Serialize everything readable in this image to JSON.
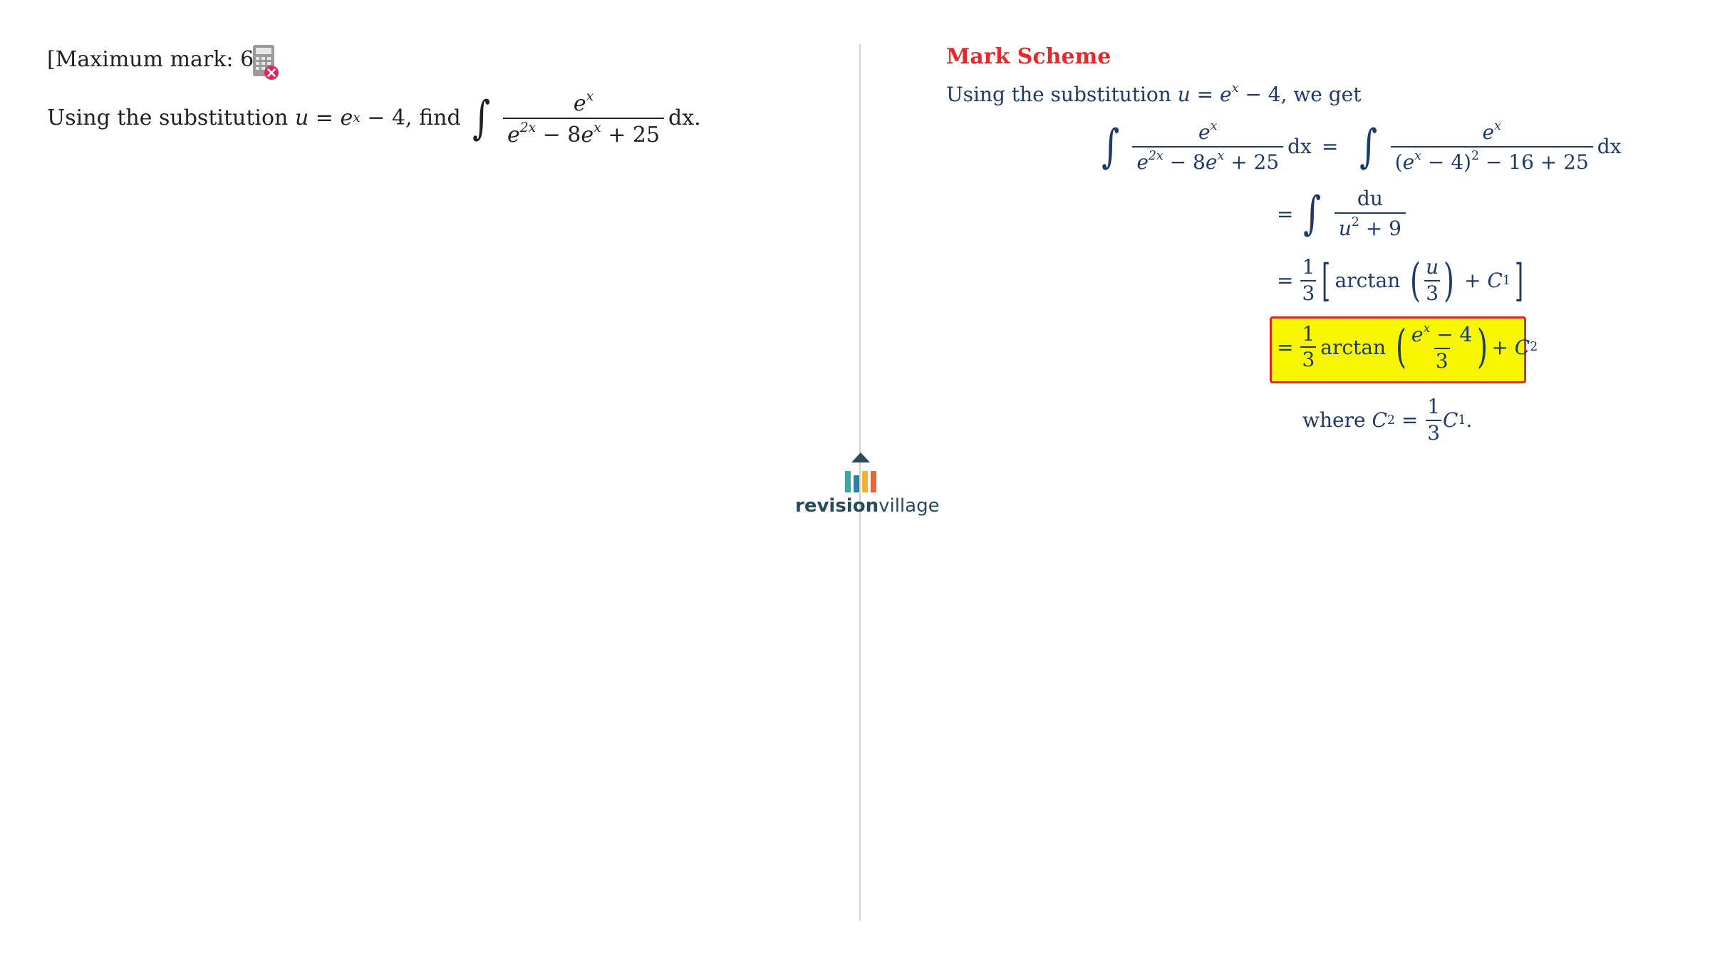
{
  "question": {
    "max_mark": "[Maximum mark: 6]",
    "calculator_icon": "calculator-not-allowed-icon",
    "text_prefix": "Using the substitution",
    "sub_u": "u",
    "sub_eq": " = ",
    "sub_e": "e",
    "sub_x": "x",
    "sub_tail": " − 4, find",
    "integral": "∫",
    "num_e": "e",
    "num_x": "x",
    "den_e1": "e",
    "den_2x": "2x",
    "den_mid": " − 8",
    "den_e2": "e",
    "den_x": "x",
    "den_tail": " + 25",
    "dx": "dx."
  },
  "mark_scheme": {
    "title": "Mark Scheme",
    "intro_prefix": "Using the substitution",
    "intro_u": "u",
    "intro_eq": " = ",
    "intro_e": "e",
    "intro_x": "x",
    "intro_tail": " − 4, we get",
    "step1": {
      "int": "∫",
      "num_e": "e",
      "num_x": "x",
      "den_e1": "e",
      "den_2x": "2x",
      "den_mid": " − 8",
      "den_e2": "e",
      "den_x": "x",
      "den_tail": " + 25",
      "dx": "dx",
      "eq": "=",
      "int2": "∫",
      "num2_e": "e",
      "num2_x": "x",
      "den2_open": "(",
      "den2_e": "e",
      "den2_x": "x",
      "den2_mid": " − 4)",
      "den2_sq": "2",
      "den2_tail": " − 16 + 25",
      "dx2": "dx"
    },
    "step2": {
      "eq": "=",
      "int": "∫",
      "num": "du",
      "den_u": "u",
      "den_sq": "2",
      "den_tail": " + 9"
    },
    "step3": {
      "eq": "=",
      "coef_num": "1",
      "coef_den": "3",
      "lbrack": "[",
      "arctan": "arctan",
      "lparen": "(",
      "frac_num": "u",
      "frac_den": "3",
      "rparen": ")",
      "plus": " + ",
      "c": "C",
      "c_sub": "1",
      "rbrack": "]"
    },
    "step4": {
      "eq": "=",
      "coef_num": "1",
      "coef_den": "3",
      "arctan": "arctan",
      "lparen": "(",
      "frac_num_e": "e",
      "frac_num_x": "x",
      "frac_num_tail": " − 4",
      "frac_den": "3",
      "rparen": ")",
      "plus": "+ ",
      "c": "C",
      "c_sub": "2"
    },
    "where": {
      "text": "where",
      "c": "C",
      "c_sub": "2",
      "eq": " = ",
      "coef_num": "1",
      "coef_den": "3",
      "c1": "C",
      "c1_sub": "1",
      "period": "."
    }
  },
  "logo": {
    "brand_bold": "revision",
    "brand_light": "village",
    "colors": [
      "#3aa7a3",
      "#2f7fa4",
      "#f2b234",
      "#e8643c"
    ]
  }
}
